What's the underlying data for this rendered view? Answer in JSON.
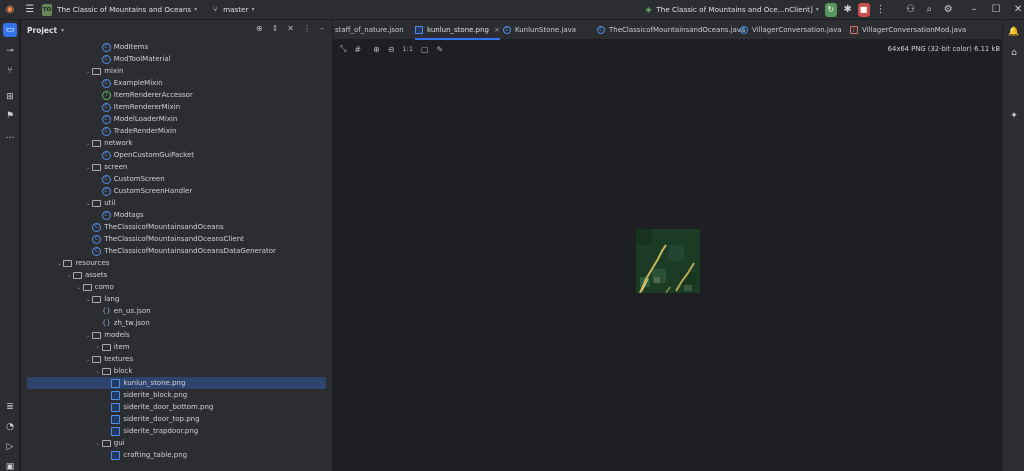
{
  "titlebar": {
    "project_badge": "TO",
    "project_name": "The Classic of Mountains and Oceans",
    "branch": "master",
    "run_config": "The Classic of Mountains and Oce...nClient]"
  },
  "project_panel": {
    "title": "Project",
    "tree": [
      {
        "label": "ModItems",
        "kind": "class",
        "depth": 8
      },
      {
        "label": "ModToolMaterial",
        "kind": "class",
        "depth": 8
      },
      {
        "label": "mixin",
        "kind": "folder",
        "depth": 7,
        "open": true
      },
      {
        "label": "ExampleMixin",
        "kind": "class",
        "depth": 8
      },
      {
        "label": "ItemRendererAccessor",
        "kind": "interface",
        "depth": 8
      },
      {
        "label": "ItemRendererMixin",
        "kind": "class",
        "depth": 8
      },
      {
        "label": "ModelLoaderMixin",
        "kind": "class",
        "depth": 8
      },
      {
        "label": "TradeRenderMixin",
        "kind": "class",
        "depth": 8
      },
      {
        "label": "network",
        "kind": "folder",
        "depth": 7,
        "open": true
      },
      {
        "label": "OpenCustomGuiPacket",
        "kind": "class",
        "depth": 8
      },
      {
        "label": "screen",
        "kind": "folder",
        "depth": 7,
        "open": true
      },
      {
        "label": "CustomScreen",
        "kind": "class",
        "depth": 8
      },
      {
        "label": "CustomScreenHandler",
        "kind": "class",
        "depth": 8
      },
      {
        "label": "util",
        "kind": "folder",
        "depth": 7,
        "open": true
      },
      {
        "label": "Modtags",
        "kind": "class",
        "depth": 8
      },
      {
        "label": "TheClassicofMountainsandOceans",
        "kind": "class",
        "depth": 7
      },
      {
        "label": "TheClassicofMountainsandOceansClient",
        "kind": "class",
        "depth": 7
      },
      {
        "label": "TheClassicofMountainsandOceansDataGenerator",
        "kind": "class",
        "depth": 7
      },
      {
        "label": "resources",
        "kind": "folder",
        "depth": 4,
        "open": true
      },
      {
        "label": "assets",
        "kind": "folder",
        "depth": 5,
        "open": true
      },
      {
        "label": "como",
        "kind": "folder",
        "depth": 6,
        "open": true
      },
      {
        "label": "lang",
        "kind": "folder",
        "depth": 7,
        "open": true
      },
      {
        "label": "en_us.json",
        "kind": "json",
        "depth": 8
      },
      {
        "label": "zh_tw.json",
        "kind": "json",
        "depth": 8
      },
      {
        "label": "models",
        "kind": "folder",
        "depth": 7,
        "open": true
      },
      {
        "label": "item",
        "kind": "folder",
        "depth": 8,
        "open": false
      },
      {
        "label": "textures",
        "kind": "folder",
        "depth": 7,
        "open": true
      },
      {
        "label": "block",
        "kind": "folder",
        "depth": 8,
        "open": true
      },
      {
        "label": "kunlun_stone.png",
        "kind": "png",
        "depth": 9,
        "selected": true
      },
      {
        "label": "siderite_block.png",
        "kind": "png",
        "depth": 9
      },
      {
        "label": "siderite_door_bottom.png",
        "kind": "png",
        "depth": 9
      },
      {
        "label": "siderite_door_top.png",
        "kind": "png",
        "depth": 9
      },
      {
        "label": "siderite_trapdoor.png",
        "kind": "png",
        "depth": 9
      },
      {
        "label": "gui",
        "kind": "folder",
        "depth": 8,
        "open": true
      },
      {
        "label": "crafting_table.png",
        "kind": "png",
        "depth": 9
      }
    ]
  },
  "tabs": [
    {
      "label": "staff_of_nature.json",
      "kind": "json",
      "active": false
    },
    {
      "label": "kunlun_stone.png",
      "kind": "png",
      "active": true
    },
    {
      "label": "KunlunStone.java",
      "kind": "class",
      "active": false
    },
    {
      "label": "TheClassicofMountainsandOceans.java",
      "kind": "class",
      "active": false
    },
    {
      "label": "VillagerConversation.java",
      "kind": "class",
      "active": false
    },
    {
      "label": "VillagerConversationMod.java",
      "kind": "java2",
      "active": false
    }
  ],
  "image_viewer": {
    "info": "64x64 PNG (32-bit color) 6.11 kB",
    "zoom_actual_label": "1:1"
  },
  "colors": {
    "accent": "#3574f0",
    "run_green": "#57965c",
    "stop_red": "#c94f4f",
    "selection": "#2e436e"
  }
}
